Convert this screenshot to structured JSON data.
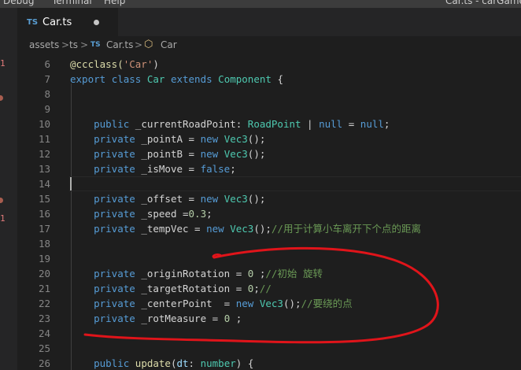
{
  "menubar": {
    "items": [
      "Debug",
      "Terminal",
      "Help"
    ],
    "window_title": "Car.ts - carGame_"
  },
  "strip": {
    "marks": [
      "1",
      "1"
    ]
  },
  "tab": {
    "lang": "TS",
    "filename": "Car.ts"
  },
  "breadcrumb": {
    "items": [
      "assets",
      "ts",
      "Car.ts",
      "Car"
    ],
    "file_lang": "TS",
    "separator": ">"
  },
  "editor": {
    "lines": [
      {
        "num": "6",
        "tokens": [
          {
            "t": "@ccclass(",
            "c": "dec"
          },
          {
            "t": "'Car'",
            "c": "str"
          },
          {
            "t": ")",
            "c": "pl"
          }
        ]
      },
      {
        "num": "7",
        "tokens": [
          {
            "t": "export ",
            "c": "kw"
          },
          {
            "t": "class ",
            "c": "kw"
          },
          {
            "t": "Car ",
            "c": "cls"
          },
          {
            "t": "extends ",
            "c": "kw"
          },
          {
            "t": "Component ",
            "c": "cls"
          },
          {
            "t": "{",
            "c": "pl"
          }
        ]
      },
      {
        "num": "8",
        "tokens": []
      },
      {
        "num": "9",
        "tokens": []
      },
      {
        "num": "10",
        "tokens": [
          {
            "t": "    public ",
            "c": "kw"
          },
          {
            "t": "_currentRoadPoint",
            "c": "pl"
          },
          {
            "t": ": ",
            "c": "pl"
          },
          {
            "t": "RoadPoint",
            "c": "cls"
          },
          {
            "t": " | ",
            "c": "pl"
          },
          {
            "t": "null",
            "c": "kw"
          },
          {
            "t": " = ",
            "c": "pl"
          },
          {
            "t": "null",
            "c": "kw"
          },
          {
            "t": ";",
            "c": "pl"
          }
        ]
      },
      {
        "num": "11",
        "tokens": [
          {
            "t": "    private ",
            "c": "kw"
          },
          {
            "t": "_pointA",
            "c": "pl"
          },
          {
            "t": " = ",
            "c": "pl"
          },
          {
            "t": "new ",
            "c": "kw"
          },
          {
            "t": "Vec3",
            "c": "cls"
          },
          {
            "t": "();",
            "c": "pl"
          }
        ]
      },
      {
        "num": "12",
        "tokens": [
          {
            "t": "    private ",
            "c": "kw"
          },
          {
            "t": "_pointB",
            "c": "pl"
          },
          {
            "t": " = ",
            "c": "pl"
          },
          {
            "t": "new ",
            "c": "kw"
          },
          {
            "t": "Vec3",
            "c": "cls"
          },
          {
            "t": "();",
            "c": "pl"
          }
        ]
      },
      {
        "num": "13",
        "tokens": [
          {
            "t": "    private ",
            "c": "kw"
          },
          {
            "t": "_isMove",
            "c": "pl"
          },
          {
            "t": " = ",
            "c": "pl"
          },
          {
            "t": "false",
            "c": "kw"
          },
          {
            "t": ";",
            "c": "pl"
          }
        ]
      },
      {
        "num": "14",
        "tokens": []
      },
      {
        "num": "15",
        "tokens": [
          {
            "t": "    private ",
            "c": "kw"
          },
          {
            "t": "_offset",
            "c": "pl"
          },
          {
            "t": " = ",
            "c": "pl"
          },
          {
            "t": "new ",
            "c": "kw"
          },
          {
            "t": "Vec3",
            "c": "cls"
          },
          {
            "t": "();",
            "c": "pl"
          }
        ]
      },
      {
        "num": "16",
        "tokens": [
          {
            "t": "    private ",
            "c": "kw"
          },
          {
            "t": "_speed",
            "c": "pl"
          },
          {
            "t": " =",
            "c": "pl"
          },
          {
            "t": "0.3",
            "c": "num"
          },
          {
            "t": ";",
            "c": "pl"
          }
        ]
      },
      {
        "num": "17",
        "tokens": [
          {
            "t": "    private ",
            "c": "kw"
          },
          {
            "t": "_tempVec",
            "c": "pl"
          },
          {
            "t": " = ",
            "c": "pl"
          },
          {
            "t": "new ",
            "c": "kw"
          },
          {
            "t": "Vec3",
            "c": "cls"
          },
          {
            "t": "();",
            "c": "pl"
          },
          {
            "t": "//用于计算小车离开下个点的距离",
            "c": "cm"
          }
        ]
      },
      {
        "num": "18",
        "tokens": []
      },
      {
        "num": "19",
        "tokens": []
      },
      {
        "num": "20",
        "tokens": [
          {
            "t": "    private ",
            "c": "kw"
          },
          {
            "t": "_originRotation",
            "c": "pl"
          },
          {
            "t": " = ",
            "c": "pl"
          },
          {
            "t": "0",
            "c": "num"
          },
          {
            "t": " ;",
            "c": "pl"
          },
          {
            "t": "//初始 旋转",
            "c": "cm"
          }
        ]
      },
      {
        "num": "21",
        "tokens": [
          {
            "t": "    private ",
            "c": "kw"
          },
          {
            "t": "_targetRotation",
            "c": "pl"
          },
          {
            "t": " = ",
            "c": "pl"
          },
          {
            "t": "0",
            "c": "num"
          },
          {
            "t": ";",
            "c": "pl"
          },
          {
            "t": "//",
            "c": "cm"
          }
        ]
      },
      {
        "num": "22",
        "tokens": [
          {
            "t": "    private ",
            "c": "kw"
          },
          {
            "t": "_centerPoint",
            "c": "pl"
          },
          {
            "t": "  = ",
            "c": "pl"
          },
          {
            "t": "new ",
            "c": "kw"
          },
          {
            "t": "Vec3",
            "c": "cls"
          },
          {
            "t": "();",
            "c": "pl"
          },
          {
            "t": "//要绕的点",
            "c": "cm"
          }
        ]
      },
      {
        "num": "23",
        "tokens": [
          {
            "t": "    private ",
            "c": "kw"
          },
          {
            "t": "_rotMeasure",
            "c": "pl"
          },
          {
            "t": " = ",
            "c": "pl"
          },
          {
            "t": "0",
            "c": "num"
          },
          {
            "t": " ;",
            "c": "pl"
          }
        ]
      },
      {
        "num": "24",
        "tokens": []
      },
      {
        "num": "25",
        "tokens": []
      },
      {
        "num": "26",
        "tokens": [
          {
            "t": "    public ",
            "c": "kw"
          },
          {
            "t": "update",
            "c": "fn"
          },
          {
            "t": "(",
            "c": "pl"
          },
          {
            "t": "dt",
            "c": "var"
          },
          {
            "t": ": ",
            "c": "pl"
          },
          {
            "t": "number",
            "c": "cls"
          },
          {
            "t": ") {",
            "c": "pl"
          }
        ]
      }
    ]
  },
  "colors": {
    "background": "#1e1e1e",
    "keyword": "#569cd6",
    "type": "#4ec9b0",
    "string": "#ce9178",
    "number": "#b5cea8",
    "comment": "#6a9955",
    "annotation": "#e0141a"
  }
}
